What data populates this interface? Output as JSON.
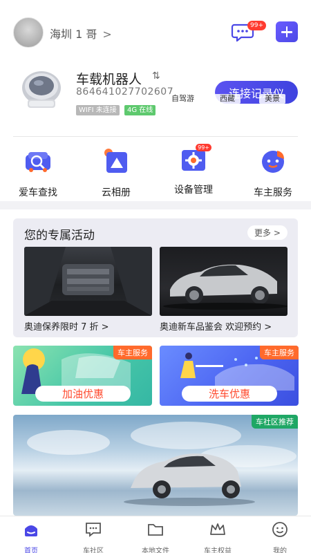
{
  "header": {
    "username": "海圳 1 哥",
    "message_badge": "99+"
  },
  "device": {
    "name": "车载机器人",
    "id": "864641027702607",
    "wifi_status": "WIFI 未连接",
    "network_status": "4G 在线",
    "connect_button": "连接记录仪"
  },
  "features": [
    {
      "label": "爱车查找",
      "icon": "car-search-icon"
    },
    {
      "label": "云相册",
      "icon": "cloud-album-icon"
    },
    {
      "label": "设备管理",
      "icon": "device-settings-icon",
      "badge": "99+"
    },
    {
      "label": "车主服务",
      "icon": "owner-service-icon"
    }
  ],
  "activities": {
    "title": "您的专属活动",
    "more": "更多",
    "items": [
      {
        "caption": "奥迪保养限时 7 折"
      },
      {
        "caption": "奥迪新车品鉴会 欢迎预约"
      }
    ]
  },
  "promos": [
    {
      "tag": "车主服务",
      "label": "加油优惠"
    },
    {
      "tag": "车主服务",
      "label": "洗车优惠"
    }
  ],
  "banner": {
    "tag": "车社区推荐",
    "chips": [
      "自驾游",
      "西藏",
      "美景"
    ]
  },
  "nav": [
    {
      "label": "首页",
      "icon": "home-icon",
      "active": true
    },
    {
      "label": "车社区",
      "icon": "community-icon"
    },
    {
      "label": "本地文件",
      "icon": "folder-icon"
    },
    {
      "label": "车主权益",
      "icon": "crown-icon"
    },
    {
      "label": "我的",
      "icon": "profile-icon"
    }
  ],
  "colors": {
    "accent": "#4a47e6",
    "badge": "#ff3b30",
    "promo_tag": "#ff6a2c",
    "community_tag": "#1fa765",
    "online": "#5ec96e"
  }
}
